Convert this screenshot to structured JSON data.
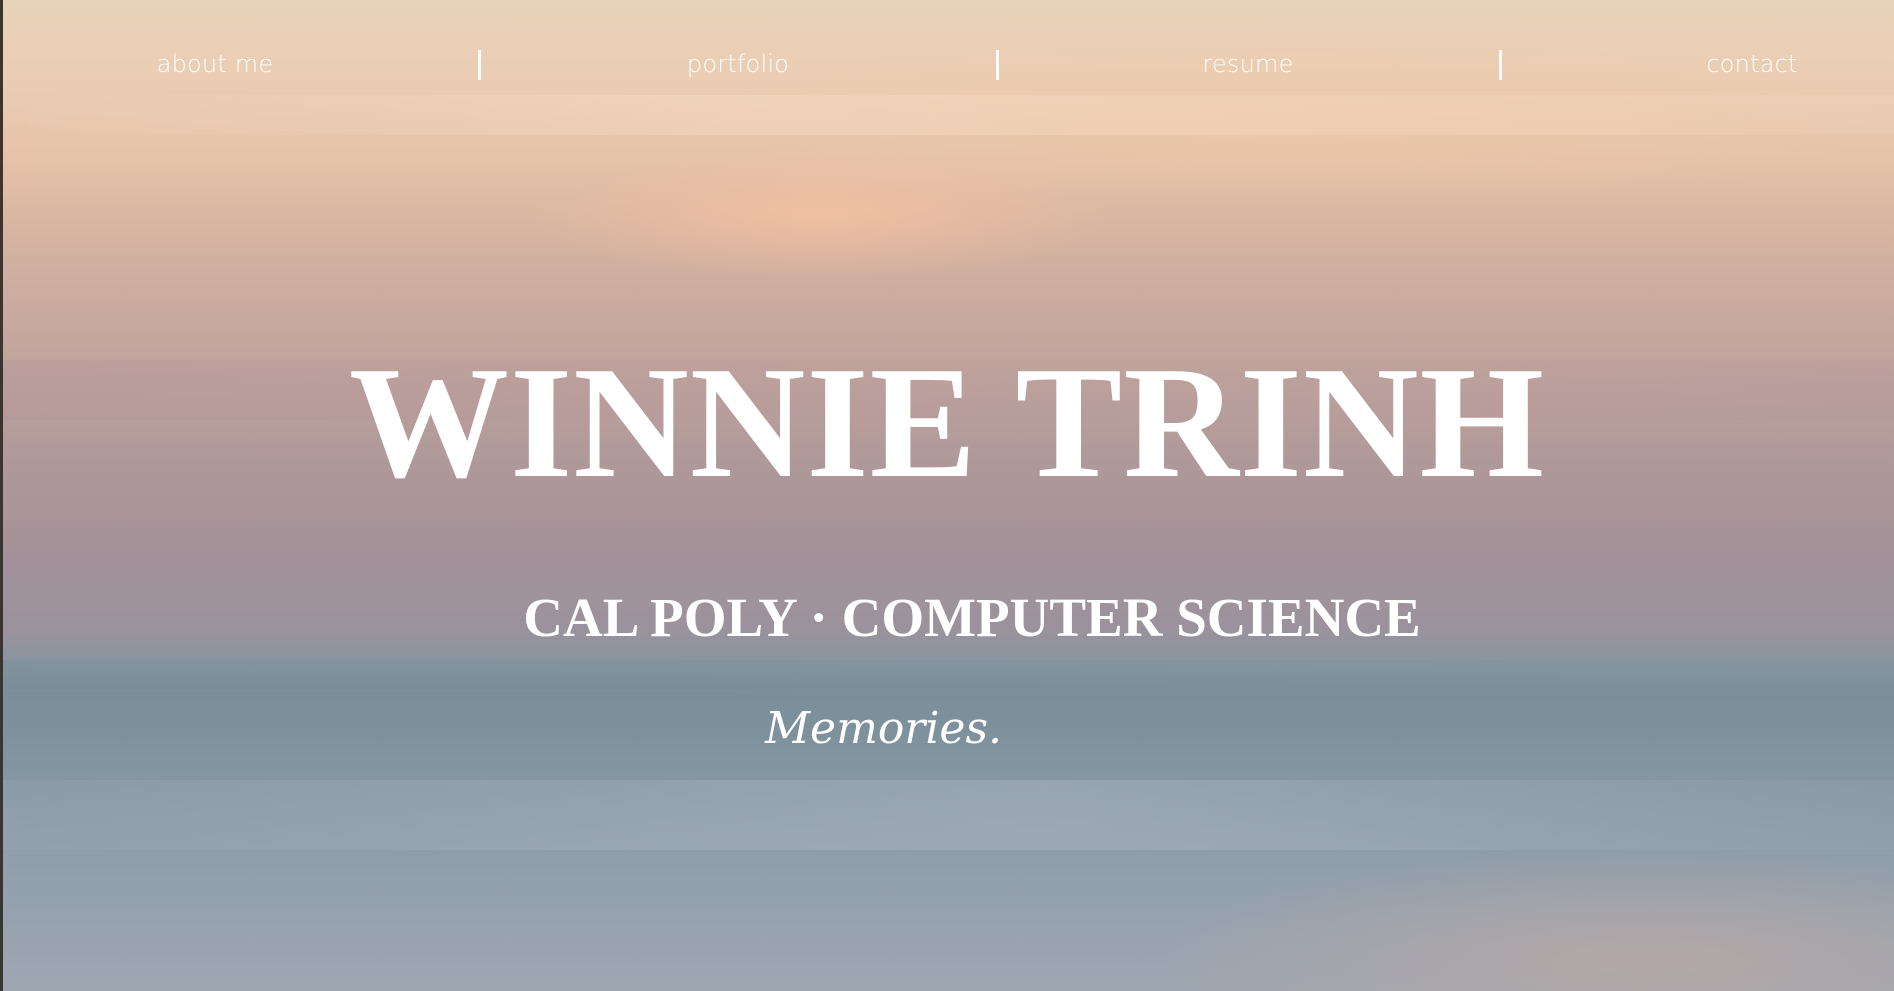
{
  "nav": {
    "items": [
      {
        "label": "about me"
      },
      {
        "label": "portfolio"
      },
      {
        "label": "resume"
      },
      {
        "label": "contact"
      }
    ],
    "separator": "|"
  },
  "hero": {
    "name": "WINNIE TRINH",
    "subtitle": "CAL POLY · COMPUTER SCIENCE",
    "typed_text": "Memories."
  },
  "colors": {
    "text": "#ffffff",
    "sky_top": "#e8d2ba",
    "sky_glow": "#f6c2a0",
    "horizon": "#7a8f9a",
    "sea_bottom": "#9ea6b1"
  }
}
